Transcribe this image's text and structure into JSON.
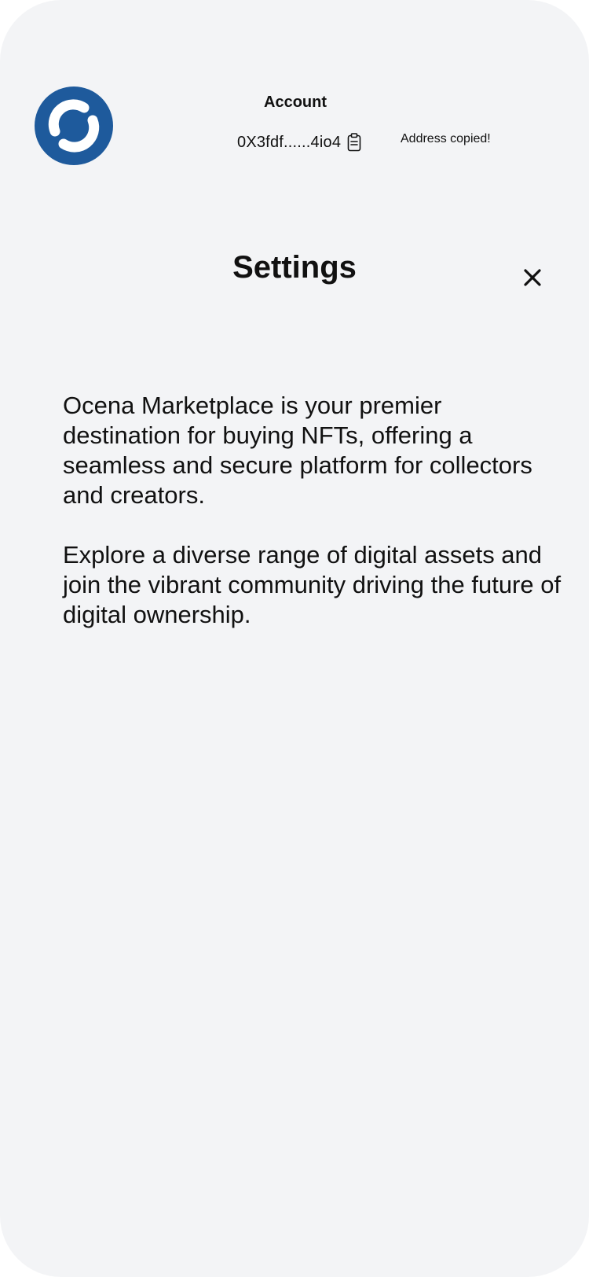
{
  "header": {
    "logo_icon": "ocean-ring-logo-icon",
    "account_label": "Account",
    "address": "0X3fdf......4io4",
    "copy_icon": "clipboard-icon",
    "copied_message": "Address copied!"
  },
  "settings": {
    "title": "Settings",
    "close_icon": "close-icon",
    "paragraphs": [
      "Ocena Marketplace is your premier destination for buying NFTs, offering a seamless and secure platform for collectors and creators.",
      "Explore a diverse range of digital assets and join the vibrant community driving the future of digital ownership."
    ]
  },
  "colors": {
    "background": "#f3f4f6",
    "logo_blue": "#1e5a9c",
    "text": "#111111"
  }
}
